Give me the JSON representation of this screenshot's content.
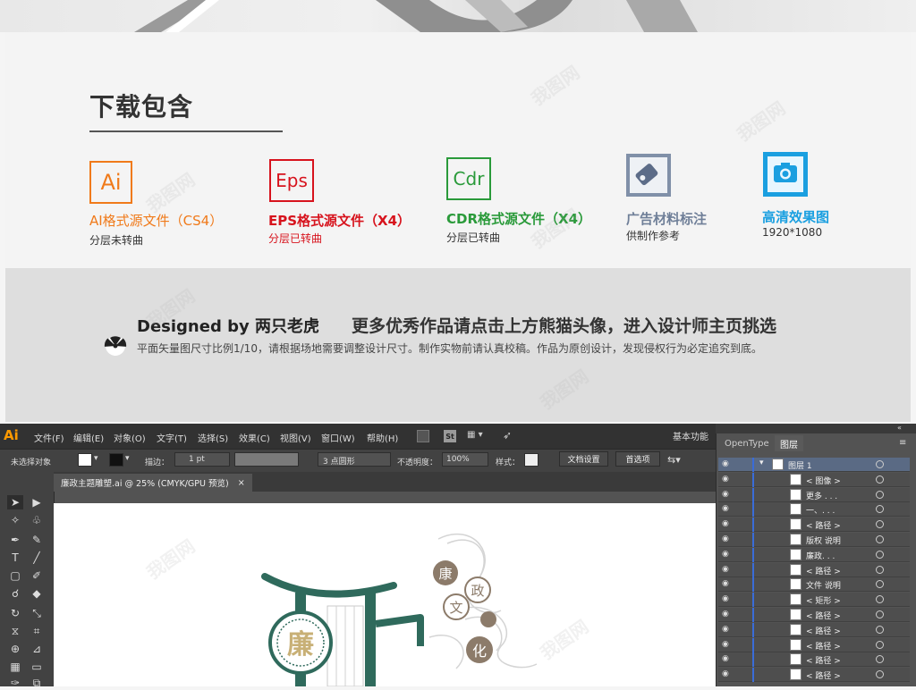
{
  "download": {
    "title": "下载包含",
    "formats": [
      {
        "icon_text": "Ai",
        "name": "AI格式源文件（CS4）",
        "sub": "分层未转曲",
        "color": "#f07a1a"
      },
      {
        "icon_text": "Eps",
        "name": "EPS格式源文件（X4）",
        "sub": "分层已转曲",
        "color": "#d7131d"
      },
      {
        "icon_text": "Cdr",
        "name": "CDR格式源文件（X4）",
        "sub": "分层已转曲",
        "color": "#2a9a3a"
      },
      {
        "icon_text": "",
        "name": "广告材料标注",
        "sub": "供制作参考",
        "color": "#6f7f98"
      },
      {
        "icon_text": "",
        "name": "高清效果图",
        "sub": "1920*1080",
        "color": "#1a9fe0"
      }
    ]
  },
  "designer": {
    "name": "Designed by 两只老虎",
    "more": "更多优秀作品请点击上方熊猫头像，进入设计师主页挑选",
    "note": "平面矢量图尺寸比例1/10，请根据场地需要调整设计尺寸。制作实物前请认真校稿。作品为原创设计，发现侵权行为必定追究到底。"
  },
  "ai_app": {
    "logo": "Ai",
    "menu": [
      "文件(F)",
      "编辑(E)",
      "对象(O)",
      "文字(T)",
      "选择(S)",
      "效果(C)",
      "视图(V)",
      "窗口(W)",
      "帮助(H)"
    ],
    "st_badge": "St",
    "workspace": "基本功能",
    "control": {
      "no_selection": "未选择对象",
      "stroke_label": "描边：",
      "stroke_value": "1 pt",
      "brush": "3 点圆形",
      "opacity_label": "不透明度：",
      "opacity_value": "100%",
      "style_label": "样式：",
      "doc_settings": "文档设置",
      "prefs": "首选项"
    },
    "doc_tab": "廉政主题雕塑.ai @ 25% (CMYK/GPU 预览)",
    "close_glyph": "×",
    "panel_tabs": [
      "OpenType",
      "图层"
    ],
    "layers": [
      {
        "name": "图层 1",
        "top": true
      },
      {
        "name": "< 图像 >"
      },
      {
        "name": "更多 . . ."
      },
      {
        "name": "一、. . ."
      },
      {
        "name": "< 路径 >"
      },
      {
        "name": "版权 说明"
      },
      {
        "name": "廉政. . ."
      },
      {
        "name": "< 路径 >"
      },
      {
        "name": "文件 说明"
      },
      {
        "name": "< 矩形 >"
      },
      {
        "name": "< 路径 >"
      },
      {
        "name": "< 路径 >"
      },
      {
        "name": "< 路径 >"
      },
      {
        "name": "< 路径 >"
      },
      {
        "name": "< 路径 >"
      }
    ],
    "artwork": {
      "seal_char": "廉",
      "circle_chars": [
        "康",
        "政",
        "文",
        "化"
      ]
    }
  },
  "watermark": "我图网"
}
